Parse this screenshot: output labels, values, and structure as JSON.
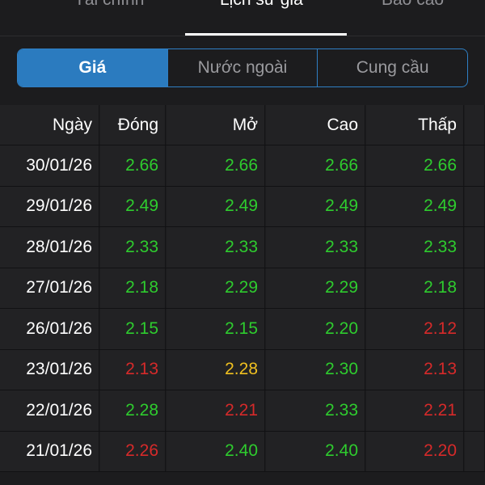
{
  "top_tabs": {
    "tab_left": "Tài chính",
    "tab_active": "Lịch sử giá",
    "tab_right": "Báo cáo"
  },
  "segments": {
    "price": "Giá",
    "foreign": "Nước ngoài",
    "supply_demand": "Cung cầu"
  },
  "table": {
    "headers": {
      "date": "Ngày",
      "close": "Đóng",
      "open": "Mở",
      "high": "Cao",
      "low": "Thấp"
    },
    "rows": [
      {
        "date": "30/01/26",
        "close": "2.66",
        "open": "2.66",
        "high": "2.66",
        "low": "2.66"
      },
      {
        "date": "29/01/26",
        "close": "2.49",
        "open": "2.49",
        "high": "2.49",
        "low": "2.49"
      },
      {
        "date": "28/01/26",
        "close": "2.33",
        "open": "2.33",
        "high": "2.33",
        "low": "2.33"
      },
      {
        "date": "27/01/26",
        "close": "2.18",
        "open": "2.29",
        "high": "2.29",
        "low": "2.18"
      },
      {
        "date": "26/01/26",
        "close": "2.15",
        "open": "2.15",
        "high": "2.20",
        "low": "2.12"
      },
      {
        "date": "23/01/26",
        "close": "2.13",
        "open": "2.28",
        "high": "2.30",
        "low": "2.13"
      },
      {
        "date": "22/01/26",
        "close": "2.28",
        "open": "2.21",
        "high": "2.33",
        "low": "2.21"
      },
      {
        "date": "21/01/26",
        "close": "2.26",
        "open": "2.40",
        "high": "2.40",
        "low": "2.20"
      }
    ]
  },
  "colors": {
    "up": "#2ecc2e",
    "down": "#d62a2a",
    "reference": "#f0c020",
    "accent": "#2b7bbf"
  }
}
